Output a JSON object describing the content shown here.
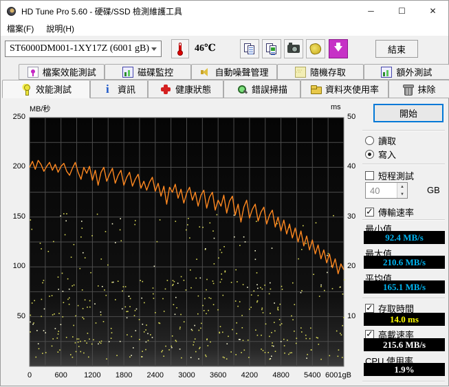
{
  "window": {
    "title": "HD Tune Pro 5.60 - 硬碟/SSD 檢測維護工具",
    "controls": {
      "minimize": "─",
      "maximize": "☐",
      "close": "✕"
    }
  },
  "menu": {
    "items": [
      {
        "label": "檔案(F)"
      },
      {
        "label": "說明(H)"
      }
    ]
  },
  "toolbar": {
    "drive_selector": "ST6000DM001-1XY17Z (6001 gB)",
    "temperature": "46℃",
    "exit_label": "結束"
  },
  "tabs": {
    "row1": [
      {
        "label": "檔案效能測試"
      },
      {
        "label": "磁碟監控"
      },
      {
        "label": "自動噪聲管理"
      },
      {
        "label": "隨機存取"
      },
      {
        "label": "額外測試"
      }
    ],
    "row2": [
      {
        "label": "效能測試",
        "active": true
      },
      {
        "label": "資訊"
      },
      {
        "label": "健康狀態"
      },
      {
        "label": "錯誤掃描"
      },
      {
        "label": "資料夾使用率"
      },
      {
        "label": "抹除"
      }
    ]
  },
  "chart_data": {
    "type": "line",
    "title": "",
    "y_left": {
      "label": "MB/秒",
      "min": 0,
      "max": 250,
      "ticks": [
        250,
        200,
        150,
        100,
        50
      ]
    },
    "y_right": {
      "label": "ms",
      "min": 0,
      "max": 50,
      "ticks": [
        50,
        40,
        30,
        20,
        10
      ]
    },
    "x": {
      "min": 0,
      "max": 6001,
      "tick_labels": [
        "0",
        "600",
        "1200",
        "1800",
        "2400",
        "3000",
        "3600",
        "4200",
        "4800",
        "5400",
        "6001gB"
      ]
    },
    "grid": {
      "on": true,
      "x_divisions": 20,
      "y_divisions": 10,
      "color": "#4d4d4d"
    },
    "series": [
      {
        "name": "transfer_rate",
        "type": "line",
        "unit": "MB/s",
        "color": "#ff8820",
        "values": [
          200,
          206,
          198,
          207,
          203,
          196,
          201,
          205,
          197,
          203,
          195,
          201,
          204,
          196,
          192,
          199,
          205,
          195,
          188,
          200,
          194,
          201,
          187,
          197,
          182,
          195,
          200,
          186,
          193,
          199,
          184,
          192,
          197,
          182,
          190,
          195,
          181,
          188,
          193,
          179,
          186,
          177,
          185,
          190,
          176,
          184,
          171,
          181,
          163,
          180,
          175,
          183,
          169,
          178,
          164,
          174,
          180,
          167,
          175,
          161,
          172,
          177,
          159,
          170,
          175,
          157,
          167,
          161,
          172,
          154,
          166,
          171,
          152,
          163,
          145,
          160,
          167,
          149,
          158,
          163,
          146,
          155,
          160,
          143,
          152,
          157,
          140,
          150,
          136,
          147,
          133,
          143,
          129,
          139,
          125,
          136,
          121,
          131,
          117,
          127,
          113,
          122,
          108,
          117,
          104,
          113,
          99,
          108,
          93,
          103,
          97
        ]
      },
      {
        "name": "access_time",
        "type": "scatter",
        "unit": "ms",
        "color": "#dcdc5a",
        "color_alt": "#fafad2",
        "generator": {
          "count": 430,
          "seed": 7,
          "bands": [
            {
              "weight": 0.45,
              "ms_min": 1.5,
              "ms_max": 9
            },
            {
              "weight": 0.35,
              "ms_min": 9,
              "ms_max": 18
            },
            {
              "weight": 0.2,
              "ms_min": 18,
              "ms_max": 31
            }
          ]
        }
      }
    ],
    "results": {
      "minimum_mbs": 92.4,
      "maximum_mbs": 210.6,
      "average_mbs": 165.1,
      "access_time_ms": 14.0,
      "burst_rate_mbs": 215.6,
      "cpu_usage_pct": 1.9
    }
  },
  "panel": {
    "start_button": "開始",
    "read_label": "讀取",
    "write_label": "寫入",
    "short_test_label": "短程測試",
    "short_test_value": "40",
    "gb_label": "GB",
    "transfer_rate_label": "傳輸速率",
    "min_label": "最小值",
    "min_value": "92.4 MB/s",
    "max_label": "最大值",
    "max_value": "210.6 MB/s",
    "avg_label": "平均值",
    "avg_value": "165.1 MB/s",
    "access_time_label": "存取時間",
    "access_time_value": "14.0 ms",
    "burst_rate_label": "高載速率",
    "burst_rate_value": "215.6 MB/s",
    "cpu_label": "CPU 使用率",
    "cpu_value": "1.9%"
  },
  "colors": {
    "accent_cyan": "#00b4f0",
    "line_orange": "#ff8820",
    "dot_yellow": "#dcdc5a",
    "value_bg": "#000000",
    "ms_yellow": "#ffff00"
  }
}
